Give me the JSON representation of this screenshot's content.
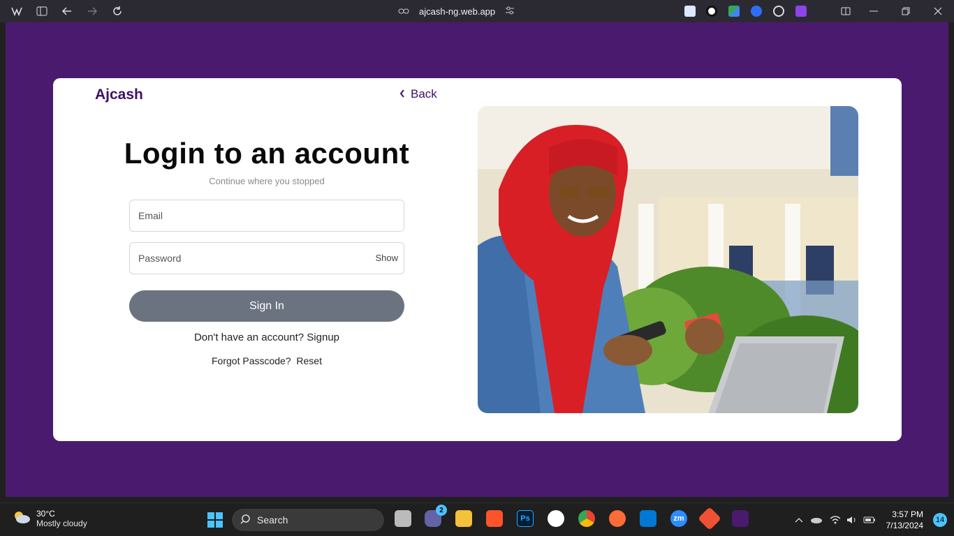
{
  "browser": {
    "url": "ajcash-ng.web.app"
  },
  "page": {
    "brand": "Ajcash",
    "back_label": "Back",
    "title": "Login to an account",
    "subtitle": "Continue where you stopped",
    "email_placeholder": "Email",
    "password_placeholder": "Password",
    "show_label": "Show",
    "signin_label": "Sign In",
    "signup_prompt": "Don't have an account?",
    "signup_link": "Signup",
    "forgot_prompt": "Forgot Passcode?",
    "reset_link": "Reset",
    "colors": {
      "background": "#4a1a6e",
      "brand": "#3d1265",
      "button": "#6c7380"
    }
  },
  "taskbar": {
    "weather_temp": "30°C",
    "weather_desc": "Mostly cloudy",
    "search_label": "Search",
    "chat_badge": "2",
    "time": "3:57 PM",
    "date": "7/13/2024",
    "notification_count": "14"
  }
}
